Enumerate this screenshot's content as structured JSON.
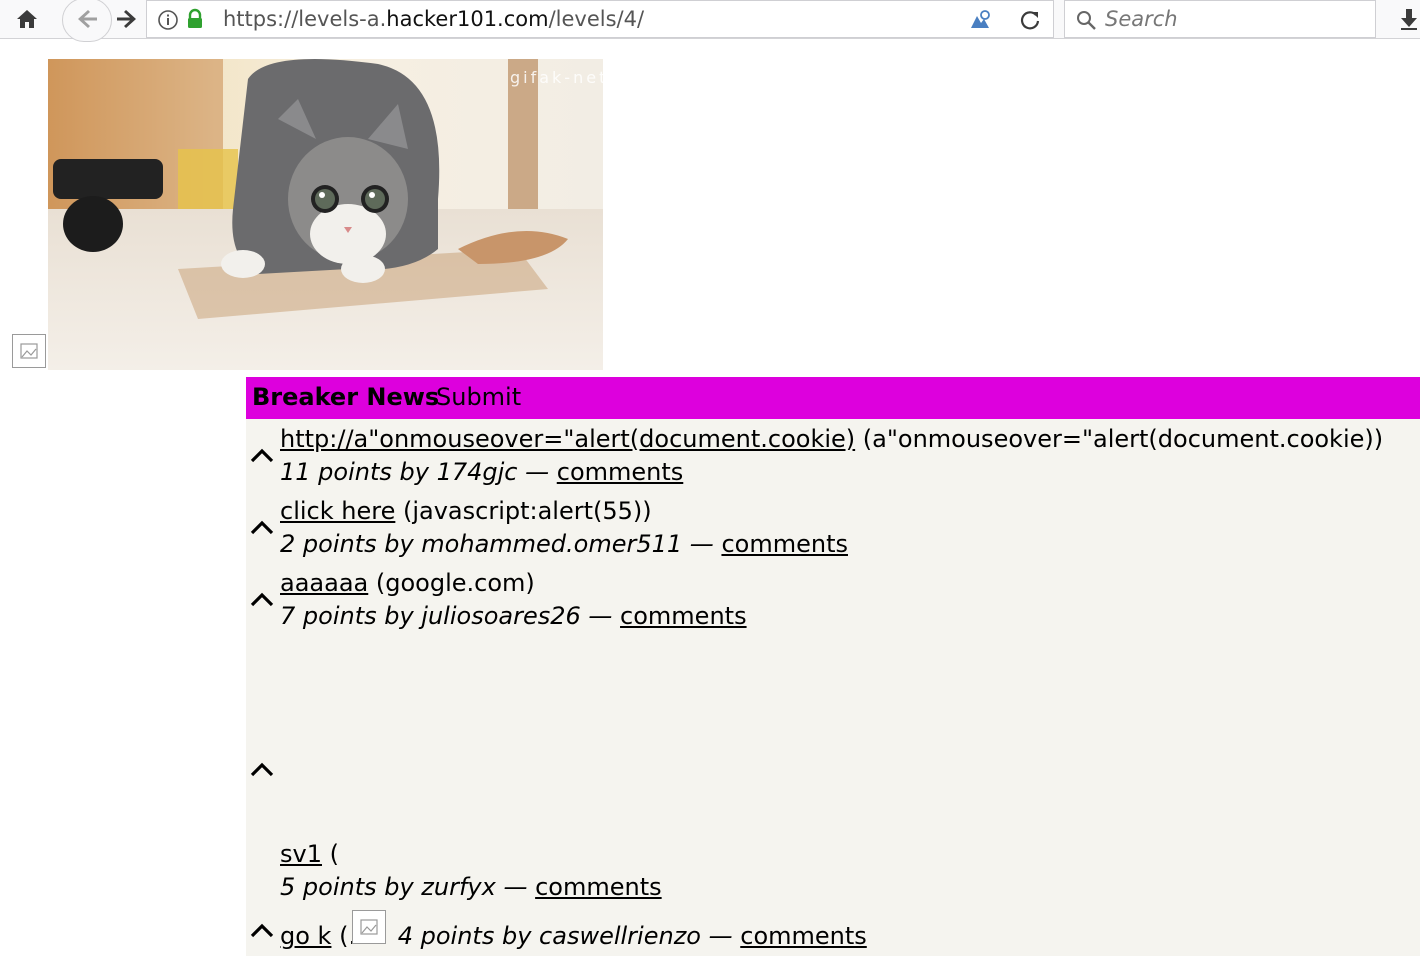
{
  "browser": {
    "url_prefix": "https://levels-a.",
    "url_domain": "hacker101.com",
    "url_path": "/levels/4/",
    "search_placeholder": "Search"
  },
  "header": {
    "title": "Breaker News",
    "submit_label": "Submit"
  },
  "stories": [
    {
      "title": "http://a\"onmouseover=\"alert(document.cookie)",
      "domain": "(a\"onmouseover=\"alert(document.cookie))",
      "meta": "11 points by 174gjc —",
      "comments": "comments"
    },
    {
      "title": "click here",
      "domain": "(javascript:alert(55))",
      "meta": "2 points by mohammed.omer511 —",
      "comments": "comments"
    },
    {
      "title": "aaaaaa",
      "domain": "(google.com)",
      "meta": "7 points by juliosoares26 —",
      "comments": "comments"
    },
    {
      "title": "sv1",
      "domain": "(",
      "meta": "5 points by zurfyx —",
      "comments": "comments"
    },
    {
      "title": "go k",
      "domain": "(.",
      "meta": "4 points by caswellrienzo —",
      "comments": "comments"
    }
  ],
  "image_watermark": "gifak-net",
  "colors": {
    "header_bg": "#dd00dd",
    "content_bg": "#f5f4ef",
    "lock": "#2fa12f"
  }
}
